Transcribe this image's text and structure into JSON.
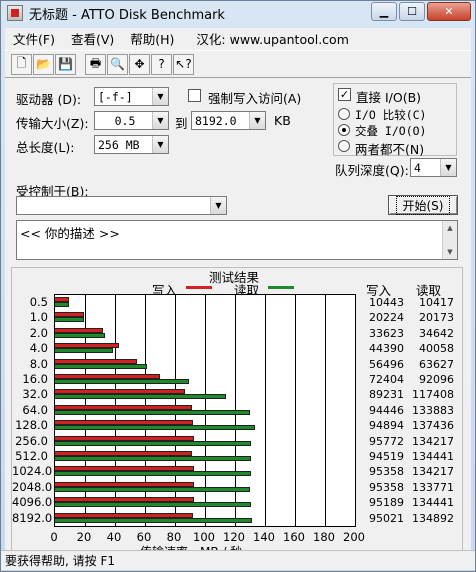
{
  "window": {
    "title": "无标题 - ATTO Disk Benchmark"
  },
  "menu": {
    "file": "文件(F)",
    "view": "查看(V)",
    "help": "帮助(H)",
    "localized": "汉化: www.upantool.com"
  },
  "settings": {
    "drive_label": "驱动器 (D):",
    "drive_value": "[-f-]",
    "force_write_label": "强制写入访问(A)",
    "force_write_checked": false,
    "transfer_size_label": "传输大小(Z):",
    "transfer_from": "0.5",
    "to_label": "到",
    "transfer_to": "8192.0",
    "kb_label": "KB",
    "total_length_label": "总长度(L):",
    "total_length_value": "256 MB",
    "direct_io_label": "直接 I/O(B)",
    "direct_io_checked": true,
    "io_compare_label": "I/O 比较(C)",
    "overlapped_io_label": "交叠 I/O(O)",
    "neither_label": "两者都不(N)",
    "selected_mode": "overlapped",
    "queue_depth_label": "队列深度(Q):",
    "queue_depth_value": "4",
    "controlled_by_label": "受控制于(B):",
    "controlled_by_value": "",
    "start_button": "开始(S)",
    "description": "<<   你的描述   >>"
  },
  "results": {
    "title": "测试结果",
    "legend_write": "写入",
    "legend_read": "读取",
    "col_write": "写入",
    "col_read": "读取",
    "xlabel": "传输速率 - MB / 秒",
    "rows": [
      {
        "size": "0.5",
        "write": "10443",
        "read": "10417"
      },
      {
        "size": "1.0",
        "write": "20224",
        "read": "20173"
      },
      {
        "size": "2.0",
        "write": "33623",
        "read": "34642"
      },
      {
        "size": "4.0",
        "write": "44390",
        "read": "40058"
      },
      {
        "size": "8.0",
        "write": "56496",
        "read": "63627"
      },
      {
        "size": "16.0",
        "write": "72404",
        "read": "92096"
      },
      {
        "size": "32.0",
        "write": "89231",
        "read": "117408"
      },
      {
        "size": "64.0",
        "write": "94446",
        "read": "133883"
      },
      {
        "size": "128.0",
        "write": "94894",
        "read": "137436"
      },
      {
        "size": "256.0",
        "write": "95772",
        "read": "134217"
      },
      {
        "size": "512.0",
        "write": "94519",
        "read": "134441"
      },
      {
        "size": "1024.0",
        "write": "95358",
        "read": "134217"
      },
      {
        "size": "2048.0",
        "write": "95358",
        "read": "133771"
      },
      {
        "size": "4096.0",
        "write": "95189",
        "read": "134441"
      },
      {
        "size": "8192.0",
        "write": "95021",
        "read": "134892"
      }
    ]
  },
  "chart_data": {
    "type": "bar",
    "title": "测试结果",
    "xlabel": "传输速率 - MB / 秒",
    "xlim": [
      0,
      200
    ],
    "xticks": [
      0,
      20,
      40,
      60,
      80,
      100,
      120,
      140,
      160,
      180,
      200
    ],
    "categories": [
      "0.5",
      "1.0",
      "2.0",
      "4.0",
      "8.0",
      "16.0",
      "32.0",
      "64.0",
      "128.0",
      "256.0",
      "512.0",
      "1024.0",
      "2048.0",
      "4096.0",
      "8192.0"
    ],
    "series": [
      {
        "name": "写入",
        "color": "#d42020",
        "values": [
          10.2,
          19.8,
          32.8,
          43.3,
          55.2,
          70.7,
          87.1,
          92.2,
          92.7,
          93.5,
          92.3,
          93.1,
          93.1,
          93.0,
          92.8
        ]
      },
      {
        "name": "读取",
        "color": "#1f8a2a",
        "values": [
          10.2,
          19.7,
          33.8,
          39.1,
          62.1,
          89.9,
          114.7,
          130.7,
          134.2,
          131.1,
          131.3,
          131.1,
          130.6,
          131.3,
          131.7
        ]
      }
    ],
    "grid": true,
    "orientation": "horizontal"
  },
  "status": {
    "text": "要获得帮助, 请按 F1"
  }
}
